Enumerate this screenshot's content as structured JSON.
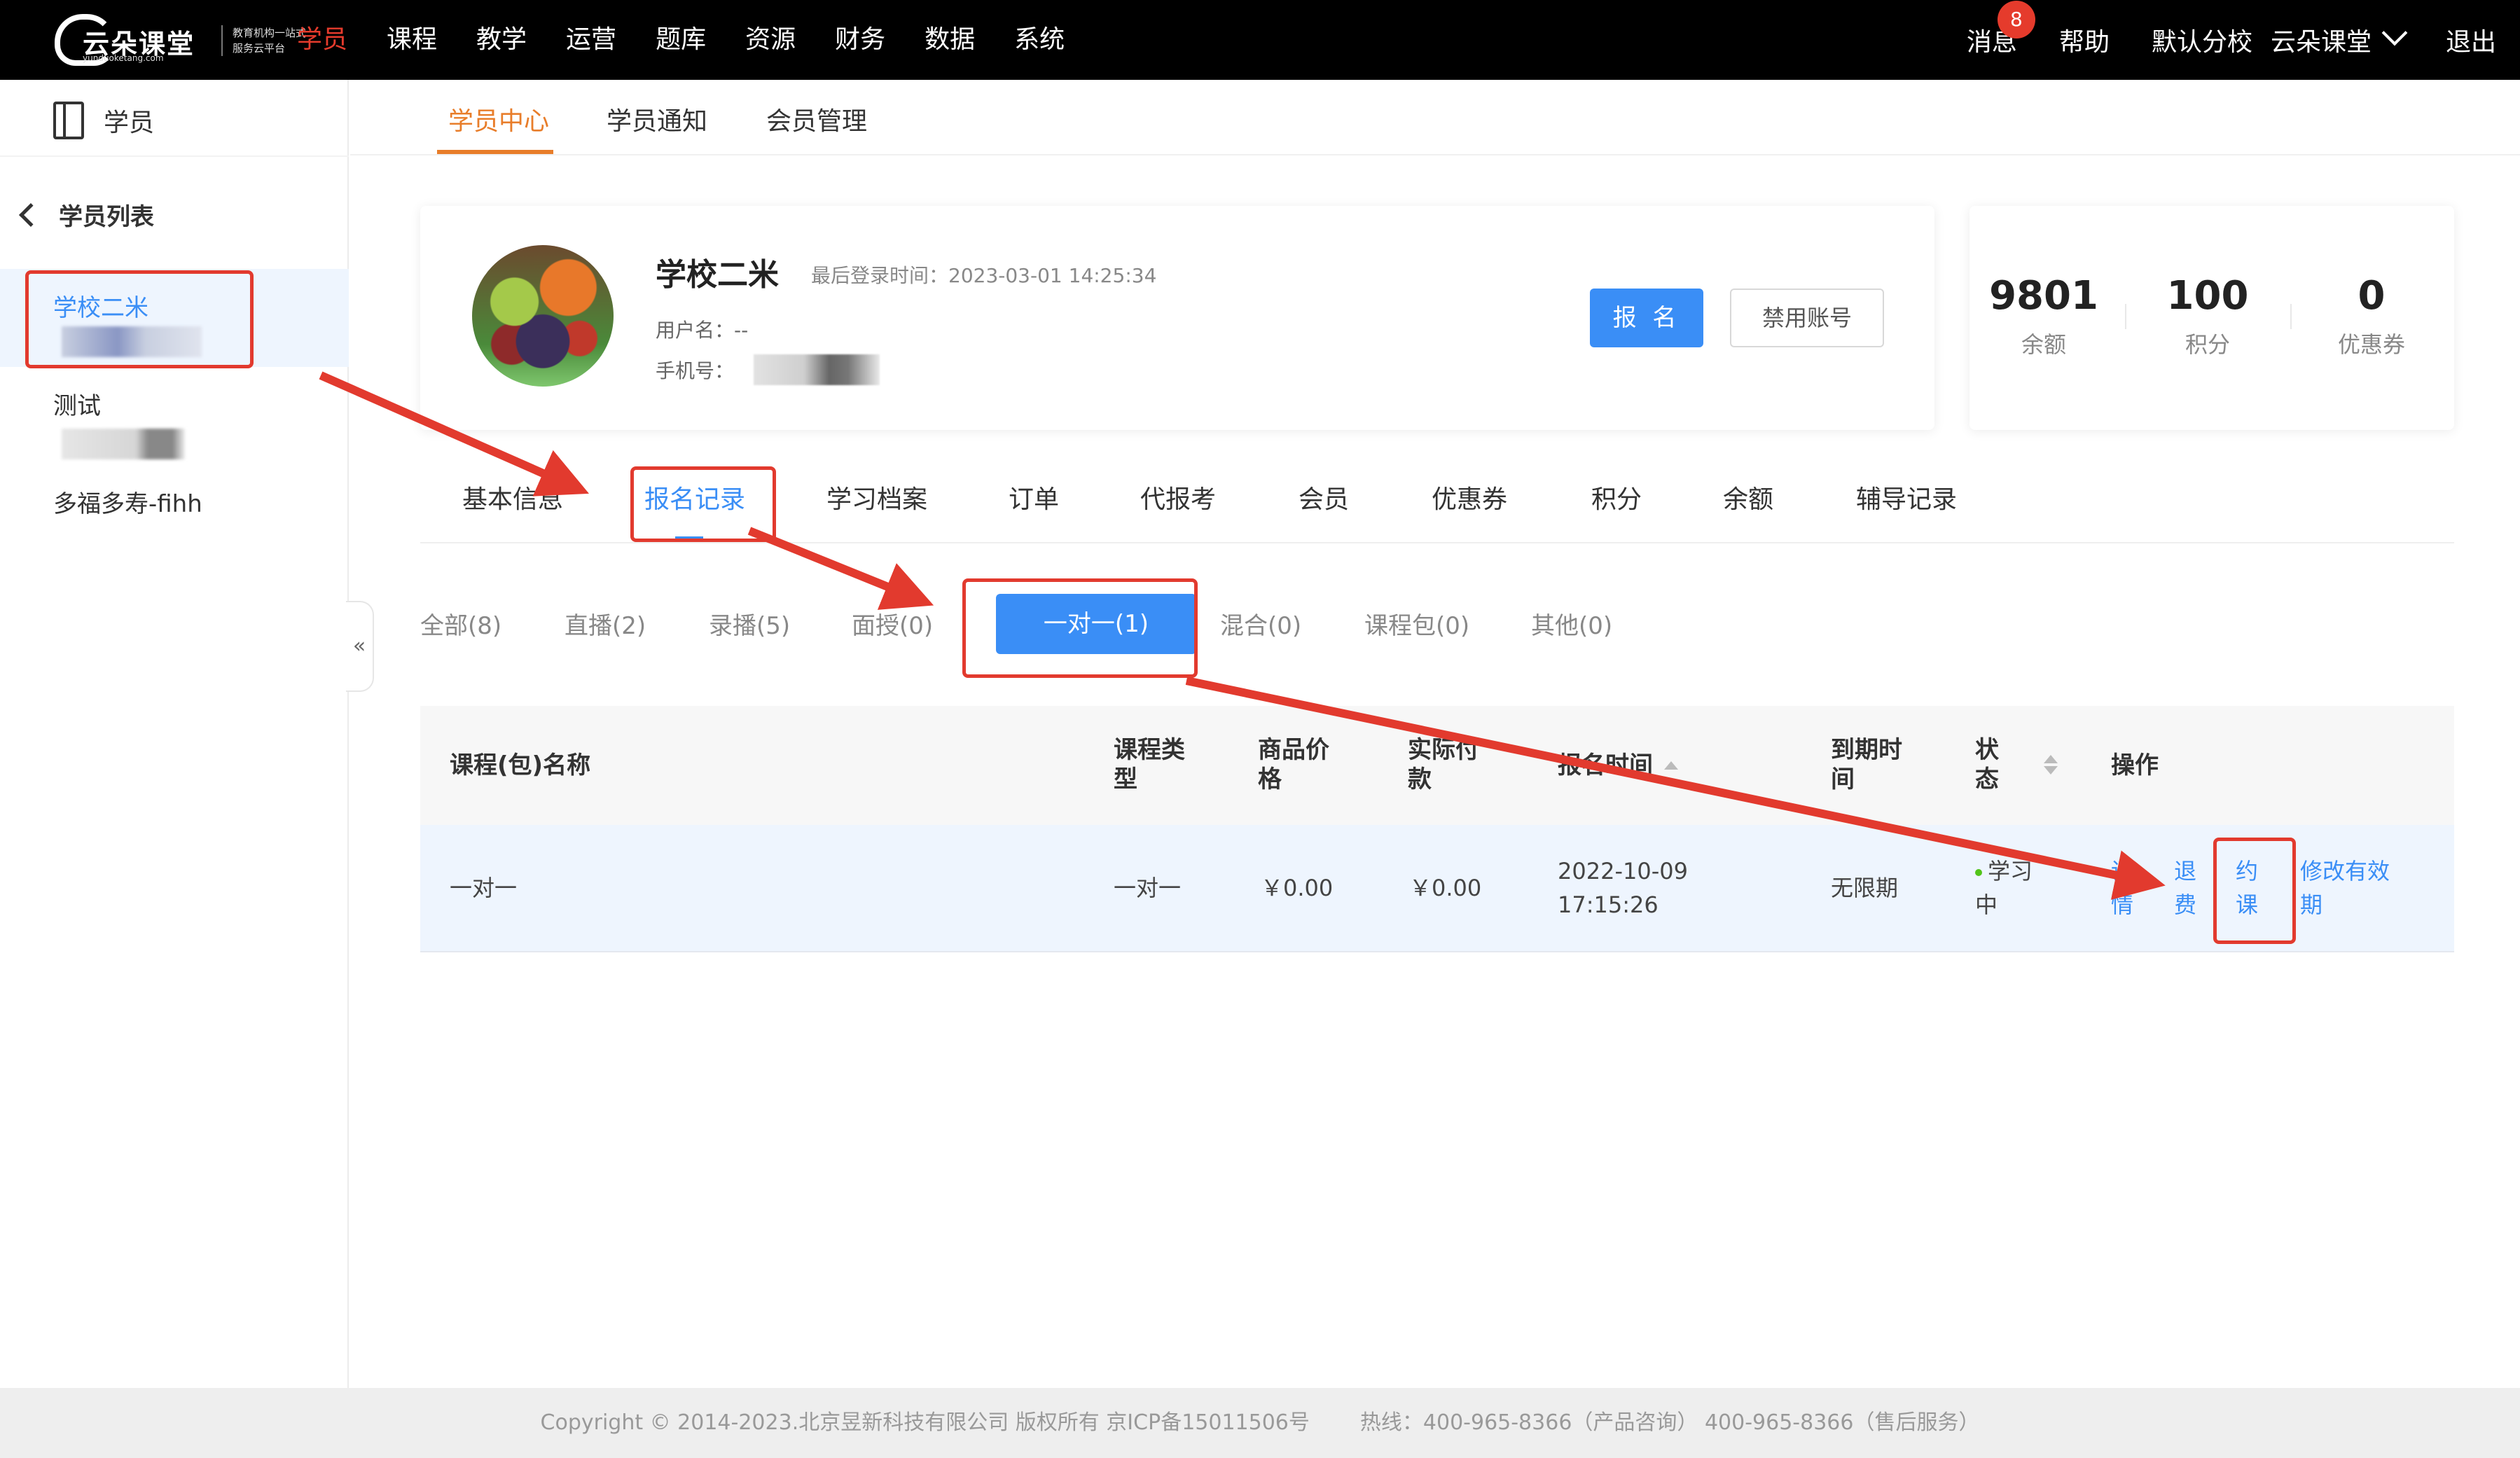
{
  "topbar": {
    "logo_text": "云朵课堂",
    "logo_sub": "yunduoketang.com",
    "logo_slogan": "教育机构一站式服务云平台",
    "nav": [
      "学员",
      "课程",
      "教学",
      "运营",
      "题库",
      "资源",
      "财务",
      "数据",
      "系统"
    ],
    "active_nav": "学员",
    "messages_label": "消息",
    "messages_badge": "8",
    "help_label": "帮助",
    "school_label": "默认分校",
    "account_label": "云朵课堂",
    "logout_label": "退出"
  },
  "sidebar": {
    "title": "学员",
    "back_label": "学员列表",
    "students": [
      {
        "name": "学校二米",
        "selected": true
      },
      {
        "name": "测试",
        "selected": false
      },
      {
        "name": "多福多寿-fihh",
        "selected": false
      }
    ],
    "collapse_label": "«"
  },
  "subnav": {
    "tabs": [
      "学员中心",
      "学员通知",
      "会员管理"
    ],
    "active": "学员中心"
  },
  "profile": {
    "name": "学校二米",
    "last_login": "最后登录时间：2023-03-01 14:25:34",
    "username": "用户名：--",
    "phone_label": "手机号：",
    "enroll_button": "报 名",
    "disable_button": "禁用账号"
  },
  "stats": [
    {
      "value": "9801",
      "label": "余额"
    },
    {
      "value": "100",
      "label": "积分"
    },
    {
      "value": "0",
      "label": "优惠券"
    }
  ],
  "record_tabs": {
    "items": [
      "基本信息",
      "报名记录",
      "学习档案",
      "订单",
      "代报考",
      "会员",
      "优惠券",
      "积分",
      "余额",
      "辅导记录"
    ],
    "active": "报名记录"
  },
  "filters": {
    "items": [
      "全部(8)",
      "直播(2)",
      "录播(5)",
      "面授(0)",
      "一对一(1)",
      "混合(0)",
      "课程包(0)",
      "其他(0)"
    ],
    "active": "一对一(1)"
  },
  "table": {
    "headers": {
      "name": "课程(包)名称",
      "type": "课程类型",
      "price": "商品价格",
      "paid": "实际付款",
      "enroll_time": "报名时间",
      "expire": "到期时间",
      "status": "状态",
      "ops": "操作"
    },
    "rows": [
      {
        "name": "一对一",
        "type": "一对一",
        "price": "￥0.00",
        "paid": "￥0.00",
        "enroll_time": "2022-10-09 17:15:26",
        "expire": "无限期",
        "status": "学习中",
        "ops": [
          "详情",
          "退费",
          "约课",
          "修改有效期"
        ]
      }
    ]
  },
  "footer": {
    "copyright": "Copyright © 2014-2023.北京昱新科技有限公司 版权所有 京ICP备15011506号",
    "hotline": "热线：400-965-8366（产品咨询） 400-965-8366（售后服务）"
  },
  "colors": {
    "accent": "#3a8ef6",
    "brand_red": "#e53b2c",
    "subnav_orange": "#e87d2a",
    "annotation_red": "#e23a2e"
  }
}
